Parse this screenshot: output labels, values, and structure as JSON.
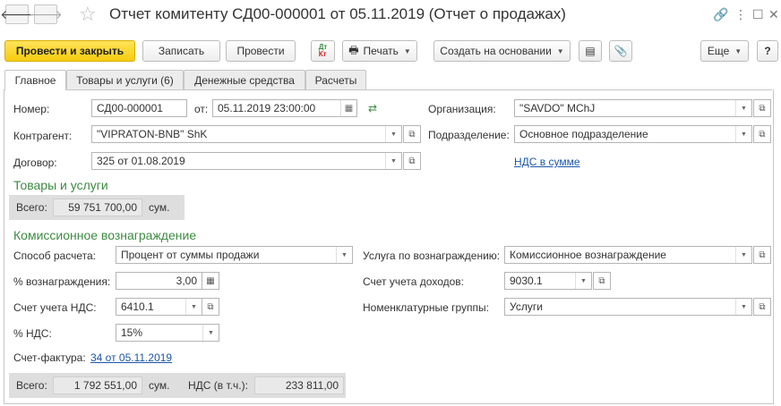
{
  "window": {
    "title": "Отчет комитенту СД00-000001 от 05.11.2019 (Отчет о продажах)"
  },
  "toolbar": {
    "post_close": "Провести и закрыть",
    "save": "Записать",
    "post": "Провести",
    "at_kt": "Дт/Кт",
    "print": "Печать",
    "create_based": "Создать на основании",
    "more": "Еще",
    "help": "?"
  },
  "tabs": [
    "Главное",
    "Товары и услуги (6)",
    "Денежные средства",
    "Расчеты"
  ],
  "header": {
    "number_label": "Номер:",
    "number_value": "СД00-000001",
    "date_label": "от:",
    "date_value": "05.11.2019 23:00:00",
    "org_label": "Организация:",
    "org_value": "\"SAVDO\" MChJ",
    "contractor_label": "Контрагент:",
    "contractor_value": "\"VIPRATON-BNB\" ShK",
    "division_label": "Подразделение:",
    "division_value": "Основное подразделение",
    "contract_label": "Договор:",
    "contract_value": "325 от 01.08.2019",
    "vat_link": "НДС в сумме"
  },
  "goods": {
    "section_title": "Товары и услуги",
    "total_label": "Всего:",
    "total_value": "59 751 700,00",
    "currency": "сум."
  },
  "commission": {
    "section_title": "Комиссионное вознаграждение",
    "method_label": "Способ расчета:",
    "method_value": "Процент от суммы продажи",
    "service_label": "Услуга по вознаграждению:",
    "service_value": "Комиссионное вознаграждение",
    "percent_label": "% вознаграждения:",
    "percent_value": "3,00",
    "income_account_label": "Счет учета доходов:",
    "income_account_value": "9030.1",
    "vat_account_label": "Счет учета НДС:",
    "vat_account_value": "6410.1",
    "nomenclature_label": "Номенклатурные группы:",
    "nomenclature_value": "Услуги",
    "vat_percent_label": "% НДС:",
    "vat_percent_value": "15%",
    "invoice_label": "Счет-фактура:",
    "invoice_link": "34 от 05.11.2019"
  },
  "footer": {
    "total_label": "Всего:",
    "total_value": "1 792 551,00",
    "currency": "сум.",
    "vat_label": "НДС (в т.ч.):",
    "vat_value": "233 811,00"
  },
  "colors": {
    "accent_yellow": "#f6cd0f",
    "section_green": "#3d8b42",
    "link_blue": "#1c56a8"
  }
}
